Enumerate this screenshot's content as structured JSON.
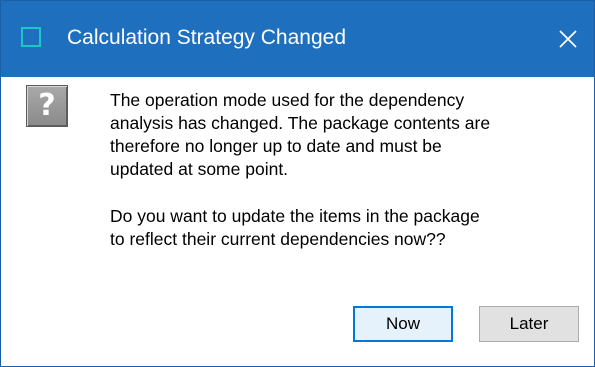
{
  "dialog": {
    "title": "Calculation Strategy Changed",
    "close_icon": "close-icon",
    "app_icon": "window-icon",
    "message_icon": "question-icon",
    "message_icon_glyph": "?",
    "paragraph_1": "The operation mode used for the dependency\nanalysis has changed. The package contents are\ntherefore no longer up to date and must be\nupdated at some point.",
    "paragraph_2": "Do you want to update the items in the package\nto reflect their current dependencies now??",
    "buttons": {
      "now_label": "Now",
      "later_label": "Later"
    }
  },
  "colors": {
    "titlebar": "#1f6fbf",
    "app_icon_outline": "#20c6c6",
    "default_button_border": "#0078d7",
    "default_button_fill": "#e5f1fb",
    "button_fill": "#e1e1e1"
  }
}
